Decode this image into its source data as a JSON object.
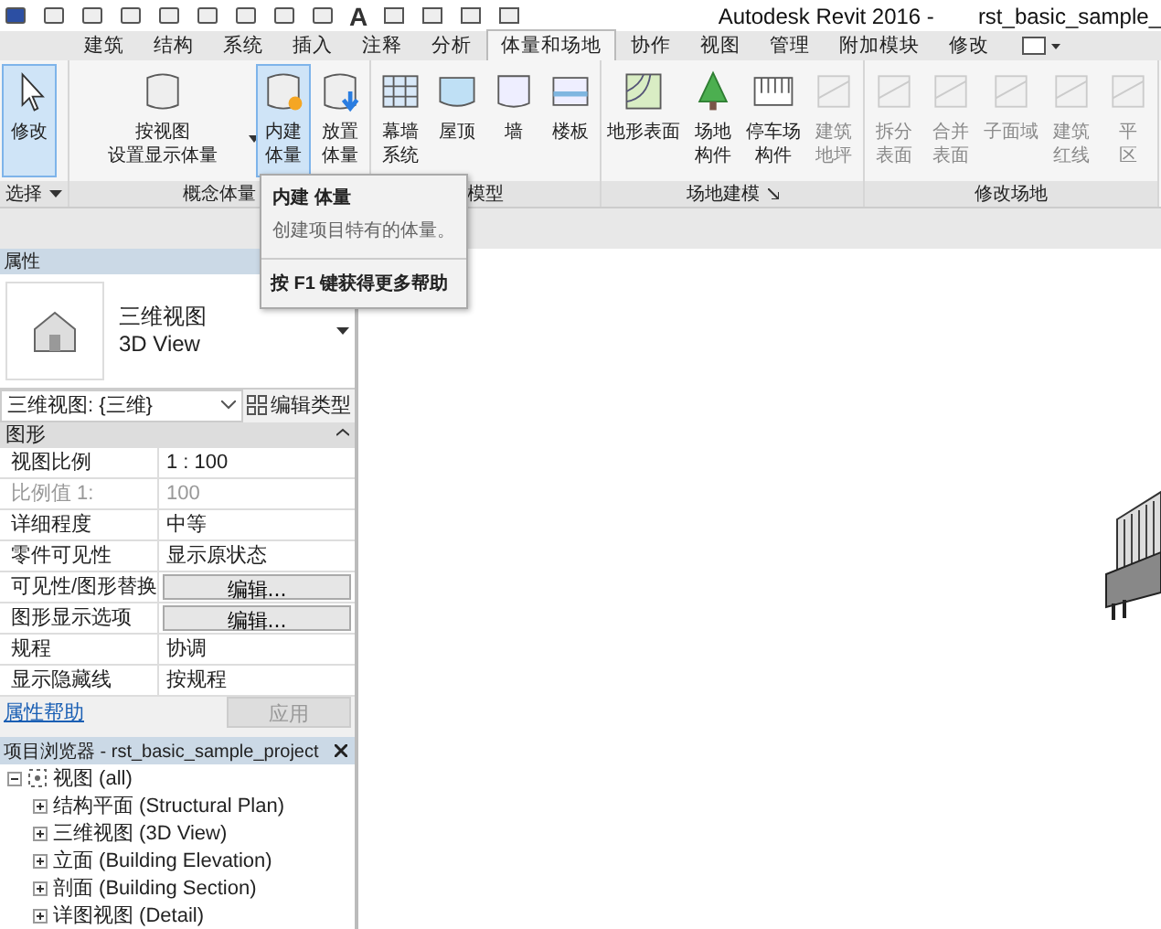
{
  "quick_access": {
    "text_tool": "A"
  },
  "title": {
    "app": "Autodesk Revit 2016 -",
    "file": "rst_basic_sample_"
  },
  "tabs": [
    {
      "label": "建筑",
      "selected": false
    },
    {
      "label": "结构",
      "selected": false
    },
    {
      "label": "系统",
      "selected": false
    },
    {
      "label": "插入",
      "selected": false
    },
    {
      "label": "注释",
      "selected": false
    },
    {
      "label": "分析",
      "selected": false
    },
    {
      "label": "体量和场地",
      "selected": true
    },
    {
      "label": "协作",
      "selected": false
    },
    {
      "label": "视图",
      "selected": false
    },
    {
      "label": "管理",
      "selected": false
    },
    {
      "label": "附加模块",
      "selected": false
    },
    {
      "label": "修改",
      "selected": false
    }
  ],
  "ribbon_panels": [
    {
      "label": "选择",
      "dropdown": true,
      "launcher": false,
      "buttons": [
        {
          "kind": "select",
          "lines": [
            "修改"
          ],
          "selected": true,
          "disabled": false
        }
      ]
    },
    {
      "label": "概念体量",
      "dropdown": false,
      "launcher": false,
      "buttons": [
        {
          "kind": "massview",
          "lines": [
            "按视图",
            "设置显示体量"
          ],
          "selected": false,
          "disabled": false,
          "menu": true
        },
        {
          "kind": "inplace",
          "lines": [
            "内建",
            "体量"
          ],
          "selected": true,
          "disabled": false
        },
        {
          "kind": "place",
          "lines": [
            "放置",
            "体量"
          ],
          "selected": false,
          "disabled": false
        }
      ]
    },
    {
      "label": "模型",
      "dropdown": false,
      "launcher": false,
      "buttons": [
        {
          "kind": "curtain",
          "lines": [
            "幕墙",
            "系统"
          ],
          "selected": false,
          "disabled": false
        },
        {
          "kind": "roof",
          "lines": [
            "屋顶"
          ],
          "selected": false,
          "disabled": false
        },
        {
          "kind": "wall",
          "lines": [
            "墙"
          ],
          "selected": false,
          "disabled": false
        },
        {
          "kind": "floor",
          "lines": [
            "楼板"
          ],
          "selected": false,
          "disabled": false
        }
      ]
    },
    {
      "label": "场地建模",
      "dropdown": false,
      "launcher": true,
      "buttons": [
        {
          "kind": "topo",
          "lines": [
            "地形表面"
          ],
          "selected": false,
          "disabled": false
        },
        {
          "kind": "tree",
          "lines": [
            "场地",
            "构件"
          ],
          "selected": false,
          "disabled": false
        },
        {
          "kind": "parking",
          "lines": [
            "停车场",
            "构件"
          ],
          "selected": false,
          "disabled": false
        },
        {
          "kind": "pad",
          "lines": [
            "建筑",
            "地坪"
          ],
          "selected": false,
          "disabled": true
        }
      ]
    },
    {
      "label": "修改场地",
      "dropdown": false,
      "launcher": false,
      "buttons": [
        {
          "kind": "split",
          "lines": [
            "拆分",
            "表面"
          ],
          "selected": false,
          "disabled": true
        },
        {
          "kind": "merge",
          "lines": [
            "合并",
            "表面"
          ],
          "selected": false,
          "disabled": true
        },
        {
          "kind": "subregion",
          "lines": [
            "子面域"
          ],
          "selected": false,
          "disabled": true
        },
        {
          "kind": "property",
          "lines": [
            "建筑",
            "红线"
          ],
          "selected": false,
          "disabled": true
        },
        {
          "kind": "grade",
          "lines": [
            "平",
            "区"
          ],
          "selected": false,
          "disabled": true
        }
      ]
    }
  ],
  "tooltip": {
    "title": "内建 体量",
    "description": "创建项目特有的体量。",
    "help": "按 F1 键获得更多帮助"
  },
  "properties": {
    "title": "属性",
    "type_name": "三维视图",
    "type_sub": "3D View",
    "view_selector": "三维视图: {三维}",
    "edit_type": "编辑类型",
    "group": "图形",
    "rows": [
      {
        "name": "视图比例",
        "value": "1 : 100",
        "kind": "text",
        "disabled": false
      },
      {
        "name": "比例值 1:",
        "value": "100",
        "kind": "text",
        "disabled": true
      },
      {
        "name": "详细程度",
        "value": "中等",
        "kind": "text",
        "disabled": false
      },
      {
        "name": "零件可见性",
        "value": "显示原状态",
        "kind": "text",
        "disabled": false
      },
      {
        "name": "可见性/图形替换",
        "value": "编辑...",
        "kind": "button",
        "disabled": false
      },
      {
        "name": "图形显示选项",
        "value": "编辑...",
        "kind": "button",
        "disabled": false
      },
      {
        "name": "规程",
        "value": "协调",
        "kind": "text",
        "disabled": false
      },
      {
        "name": "显示隐藏线",
        "value": "按规程",
        "kind": "text",
        "disabled": false
      }
    ],
    "help_link": "属性帮助",
    "apply": {
      "label": "应用",
      "disabled": true
    }
  },
  "project_browser": {
    "title": "项目浏览器 - rst_basic_sample_project",
    "tree": [
      {
        "label": "视图 (all)",
        "expanded": true,
        "children": [
          {
            "label": "结构平面 (Structural Plan)",
            "expanded": false
          },
          {
            "label": "三维视图 (3D View)",
            "expanded": false
          },
          {
            "label": "立面 (Building Elevation)",
            "expanded": false
          },
          {
            "label": "剖面 (Building Section)",
            "expanded": false
          },
          {
            "label": "详图视图 (Detail)",
            "expanded": false
          }
        ]
      }
    ]
  }
}
